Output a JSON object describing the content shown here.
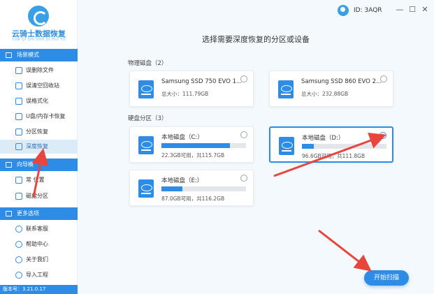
{
  "app": {
    "title": "云骑士数据恢复",
    "subtitle": "YUN QI SHI SHU JU HUI FU",
    "version": "版本号：3.21.0.17",
    "user_id": "ID: 3AQR",
    "accent": "#2d8de6"
  },
  "window_controls": {
    "minimize": "—",
    "maximize": "☐",
    "close": "✕"
  },
  "sidebar": {
    "sections": [
      {
        "title": "场景模式",
        "items": [
          {
            "label": "误删除文件",
            "icon": "trash-icon"
          },
          {
            "label": "误清空回收站",
            "icon": "recycle-bin-icon"
          },
          {
            "label": "误格式化",
            "icon": "format-icon"
          },
          {
            "label": "U盘/内存卡恢复",
            "icon": "usb-icon"
          },
          {
            "label": "分区恢复",
            "icon": "partition-icon"
          },
          {
            "label": "深度恢复",
            "icon": "deep-scan-icon",
            "active": true
          }
        ]
      },
      {
        "title": "向导模",
        "items": [
          {
            "label": "常 位置",
            "icon": "location-icon"
          },
          {
            "label": "磁盘分区",
            "icon": "disk-icon"
          }
        ]
      },
      {
        "title": "更多选项",
        "items": [
          {
            "label": "联系客服",
            "icon": "support-icon"
          },
          {
            "label": "帮助中心",
            "icon": "help-icon"
          },
          {
            "label": "关于我们",
            "icon": "info-icon"
          },
          {
            "label": "导入工程",
            "icon": "import-icon"
          }
        ]
      }
    ]
  },
  "main": {
    "title": "选择需要深度恢复的分区或设备",
    "physical_label": "物理磁盘（2）",
    "physical": [
      {
        "name": "Samsung SSD 750 EVO 1...",
        "info": "总大小：111.79GB"
      },
      {
        "name": "Samsung SSD 860 EVO 2...",
        "info": "总大小：232.88GB"
      }
    ],
    "partition_label": "硬盘分区（3）",
    "partitions": [
      {
        "name": "本地磁盘（C:）",
        "info": "22.3GB可用，共115.7GB",
        "used_fraction": 0.81,
        "selected": false
      },
      {
        "name": "本地磁盘（D:）",
        "info": "96.6GB可用，共111.8GB",
        "used_fraction": 0.14,
        "selected": true
      },
      {
        "name": "本地磁盘（E:）",
        "info": "87.0GB可用，共116.2GB",
        "used_fraction": 0.25,
        "selected": false
      }
    ],
    "scan_button": "开始扫描"
  }
}
